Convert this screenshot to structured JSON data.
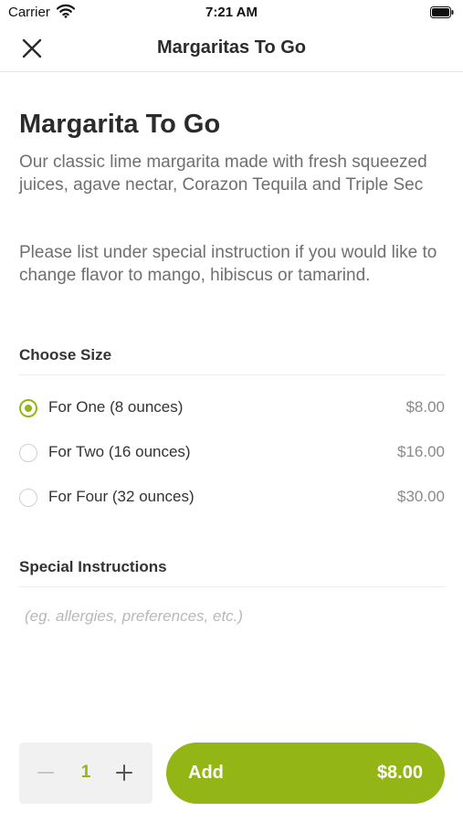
{
  "status_bar": {
    "carrier": "Carrier",
    "time": "7:21 AM"
  },
  "nav": {
    "title": "Margaritas To Go"
  },
  "product": {
    "title": "Margarita To Go",
    "description": "Our classic lime margarita made with fresh squeezed juices, agave nectar, Corazon Tequila and Triple Sec",
    "note": "Please list under special instruction if you would like to change flavor to mango, hibiscus or tamarind."
  },
  "size_section": {
    "title": "Choose Size",
    "options": [
      {
        "label": "For One (8 ounces)",
        "price": "$8.00",
        "selected": true
      },
      {
        "label": "For Two (16 ounces)",
        "price": "$16.00",
        "selected": false
      },
      {
        "label": "For Four (32 ounces)",
        "price": "$30.00",
        "selected": false
      }
    ]
  },
  "instructions_section": {
    "title": "Special Instructions",
    "placeholder": "(eg. allergies, preferences, etc.)",
    "value": ""
  },
  "footer": {
    "quantity": "1",
    "add_label": "Add",
    "add_price": "$8.00"
  },
  "colors": {
    "accent": "#93b516",
    "text": "#2b2b2b",
    "muted": "#6f6f6f"
  },
  "icons": {
    "close": "close-icon",
    "minus": "minus-icon",
    "plus": "plus-icon",
    "wifi": "wifi-icon",
    "battery": "battery-icon"
  }
}
